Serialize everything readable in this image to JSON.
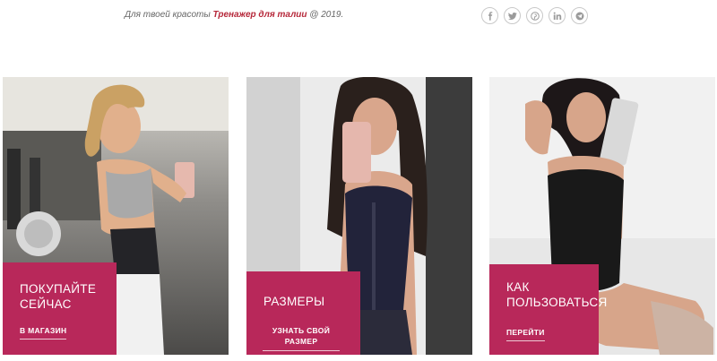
{
  "footer": {
    "copyright_prefix": "Для твоей красоты",
    "brand_link": "Тренажер для талии",
    "copyright_suffix": "@ 2019."
  },
  "social_icons": [
    "facebook-icon",
    "twitter-icon",
    "pinterest-icon",
    "linkedin-icon",
    "telegram-icon"
  ],
  "cards": [
    {
      "title": "Покупайте сейчас",
      "link": "В магазин"
    },
    {
      "title": "Размеры",
      "link": "Узнать свой размер"
    },
    {
      "title": "Как пользоваться",
      "link": "Перейти"
    }
  ],
  "colors": {
    "accent": "#b8285a",
    "link": "#b6283a"
  }
}
